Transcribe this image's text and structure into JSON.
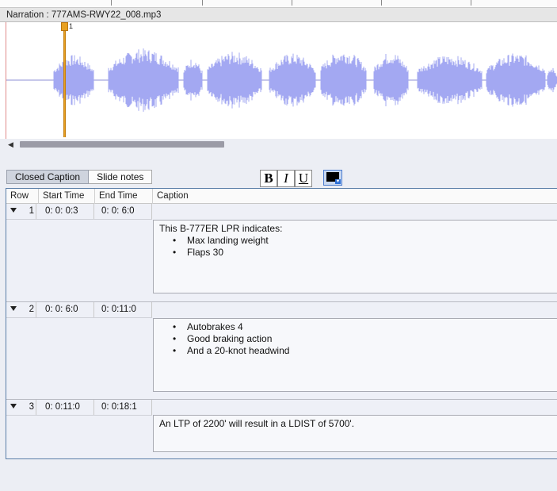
{
  "narration": {
    "label": "Narration : 777AMS-RWY22_008.mp3"
  },
  "marker": {
    "label": "1"
  },
  "tabs": [
    {
      "label": "Closed Caption",
      "active": true
    },
    {
      "label": "Slide notes",
      "active": false
    }
  ],
  "format": {
    "bold": "B",
    "italic": "I",
    "underline": "U",
    "text_color": "#000000"
  },
  "table": {
    "headers": {
      "row": "Row",
      "start": "Start Time",
      "end": "End Time",
      "caption": "Caption"
    },
    "rows": [
      {
        "row": "1",
        "start": "0: 0: 0:3",
        "end": "0: 0: 6:0",
        "caption_text": "This B-777ER LPR indicates:",
        "bullets": [
          "Max landing weight",
          "Flaps 30"
        ]
      },
      {
        "row": "2",
        "start": "0: 0: 6:0",
        "end": "0: 0:11:0",
        "caption_text": "",
        "bullets": [
          "Autobrakes 4",
          "Good braking action",
          "And a 20-knot headwind"
        ]
      },
      {
        "row": "3",
        "start": "0: 0:11:0",
        "end": "0: 0:18:1",
        "caption_text": "An LTP of 2200' will result in a LDIST of 5700'.",
        "bullets": []
      }
    ]
  },
  "colors": {
    "waveform": "#a3a8f2",
    "marker": "#e8a020",
    "accent": "#2c6fd6"
  }
}
